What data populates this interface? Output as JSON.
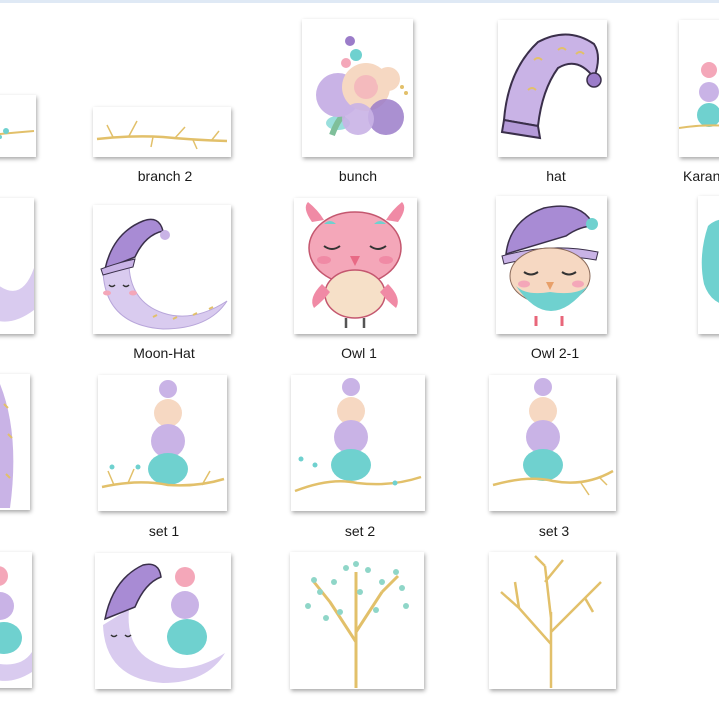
{
  "files": [
    {
      "name": "branch 2"
    },
    {
      "name": "bunch"
    },
    {
      "name": "hat"
    },
    {
      "name": "Karan"
    },
    {
      "name": "Moon-Hat"
    },
    {
      "name": "Owl 1"
    },
    {
      "name": "Owl 2-1"
    },
    {
      "name": "set 1"
    },
    {
      "name": "set 2"
    },
    {
      "name": "set 3"
    }
  ],
  "colors": {
    "lavender": "#c9b3e6",
    "purple": "#9b7cc9",
    "pink": "#f4a7b9",
    "teal": "#6fd1cf",
    "gold": "#e2c06a",
    "peach": "#f6d8c2"
  }
}
